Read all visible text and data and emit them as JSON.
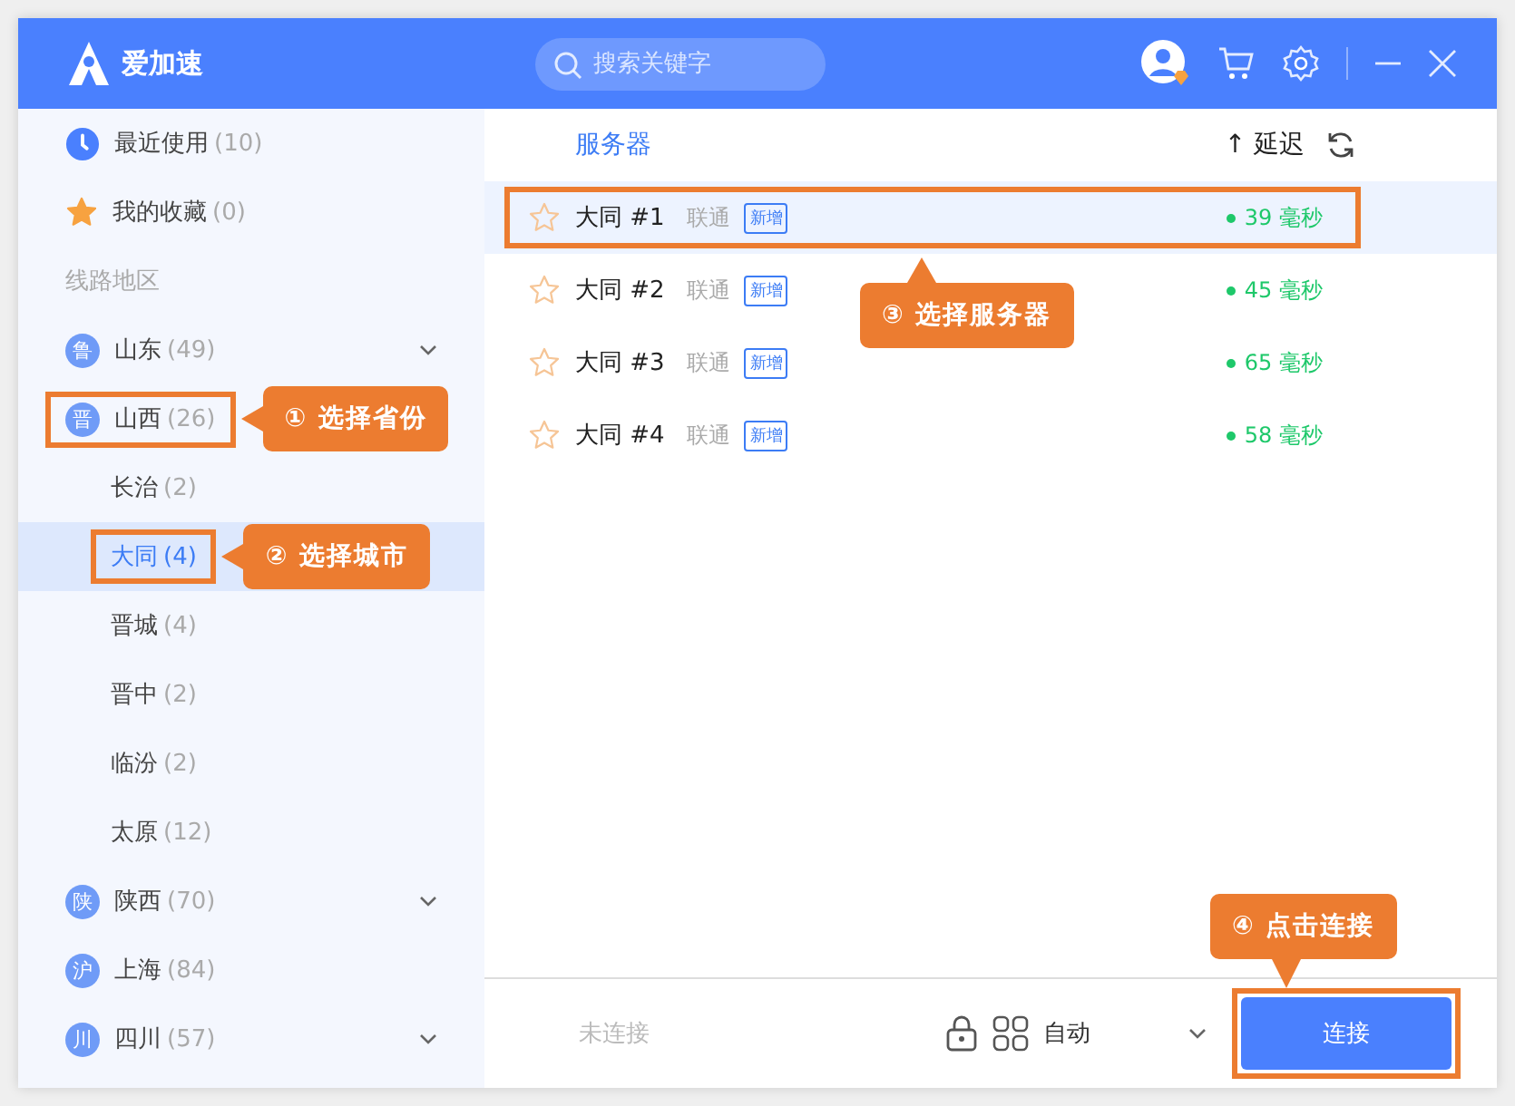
{
  "app": {
    "name": "爱加速"
  },
  "search": {
    "placeholder": "搜索关键字"
  },
  "sidebar": {
    "items": [
      {
        "kind": "recent",
        "label": "最近使用",
        "count": "(10)",
        "selected": false,
        "highlighted": false
      },
      {
        "kind": "favorites",
        "label": "我的收藏",
        "count": "(0)",
        "selected": false,
        "highlighted": false
      },
      {
        "kind": "heading",
        "label": "线路地区"
      },
      {
        "kind": "province",
        "badge": "鲁",
        "label": "山东",
        "count": "(49)",
        "expandable": true,
        "selected": false,
        "highlighted": false
      },
      {
        "kind": "province",
        "badge": "晋",
        "label": "山西",
        "count": "(26)",
        "expandable": false,
        "selected": false,
        "highlighted": true,
        "callout": "① 选择省份"
      },
      {
        "kind": "city",
        "label": "长治",
        "count": "(2)",
        "selected": false,
        "highlighted": false
      },
      {
        "kind": "city",
        "label": "大同",
        "count": "(4)",
        "selected": true,
        "highlighted": true,
        "callout": "② 选择城市"
      },
      {
        "kind": "city",
        "label": "晋城",
        "count": "(4)",
        "selected": false,
        "highlighted": false
      },
      {
        "kind": "city",
        "label": "晋中",
        "count": "(2)",
        "selected": false,
        "highlighted": false
      },
      {
        "kind": "city",
        "label": "临汾",
        "count": "(2)",
        "selected": false,
        "highlighted": false
      },
      {
        "kind": "city",
        "label": "太原",
        "count": "(12)",
        "selected": false,
        "highlighted": false
      },
      {
        "kind": "province",
        "badge": "陕",
        "label": "陕西",
        "count": "(70)",
        "expandable": true,
        "selected": false,
        "highlighted": false
      },
      {
        "kind": "province",
        "badge": "沪",
        "label": "上海",
        "count": "(84)",
        "expandable": false,
        "selected": false,
        "highlighted": false
      },
      {
        "kind": "province",
        "badge": "川",
        "label": "四川",
        "count": "(57)",
        "expandable": true,
        "selected": false,
        "highlighted": false
      }
    ]
  },
  "servers": {
    "column": "服务器",
    "sort": "↑ 延迟",
    "rows": [
      {
        "name": "大同 #1",
        "isp": "联通",
        "tag": "新增",
        "latency": "39 毫秒",
        "favorite": false,
        "selected": true,
        "highlighted": true,
        "callout": "③ 选择服务器"
      },
      {
        "name": "大同 #2",
        "isp": "联通",
        "tag": "新增",
        "latency": "45 毫秒",
        "favorite": false,
        "selected": false,
        "highlighted": false
      },
      {
        "name": "大同 #3",
        "isp": "联通",
        "tag": "新增",
        "latency": "65 毫秒",
        "favorite": false,
        "selected": false,
        "highlighted": false
      },
      {
        "name": "大同 #4",
        "isp": "联通",
        "tag": "新增",
        "latency": "58 毫秒",
        "favorite": false,
        "selected": false,
        "highlighted": false
      }
    ]
  },
  "footer": {
    "status": "未连接",
    "mode": "自动",
    "button": {
      "label": "连接",
      "highlighted": true,
      "callout": "④ 点击连接"
    }
  }
}
